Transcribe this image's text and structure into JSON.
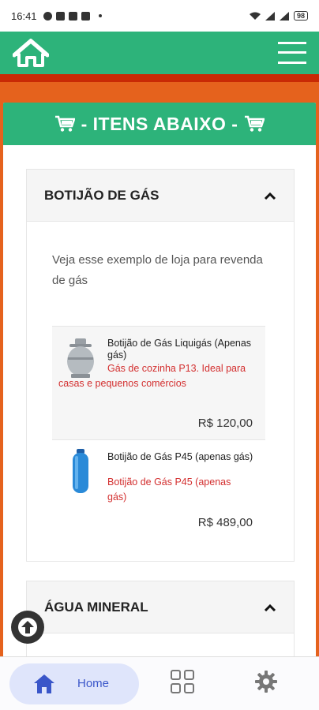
{
  "status_bar": {
    "time": "16:41",
    "battery": "98"
  },
  "header": {
    "home_icon": "house-icon",
    "menu_icon": "hamburger-menu-icon"
  },
  "card": {
    "title": "- ITENS ABAIXO -",
    "cart_icon": "cart-icon"
  },
  "sections": [
    {
      "title": "BOTIJÃO DE GÁS",
      "expanded": true,
      "description": "Veja esse exemplo de loja para revenda de gás",
      "products": [
        {
          "name": "Botijão de Gás Liquigás (Apenas gás)",
          "description": "Gás de cozinha P13. Ideal para casas e pequenos comércios",
          "price": "R$ 120,00",
          "icon": "gas-cylinder-icon"
        },
        {
          "name": "Botijão de Gás P45 (apenas gás)",
          "description": "Botijão de Gás P45 (apenas gás)",
          "price": "R$ 489,00",
          "icon": "blue-gas-cylinder-icon"
        }
      ]
    },
    {
      "title": "ÁGUA MINERAL",
      "expanded": true
    }
  ],
  "bottom_nav": {
    "home_label": "Home",
    "items": [
      "home-icon",
      "grid-icon",
      "gear-icon"
    ]
  },
  "colors": {
    "green": "#2db37a",
    "orange": "#e5621d",
    "dark_orange": "#c82a05",
    "price_red": "#d32f2f"
  }
}
